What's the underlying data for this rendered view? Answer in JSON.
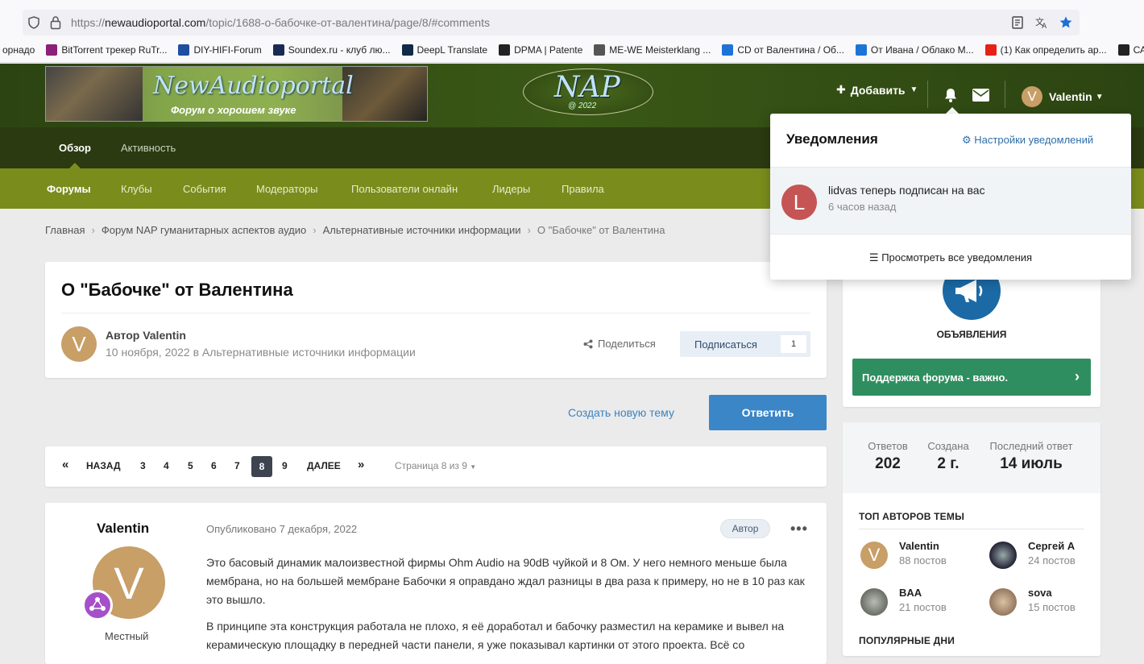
{
  "browser": {
    "url_prefix": "https://",
    "url_host": "newaudioportal.com",
    "url_path": "/topic/1688-о-бабочке-от-валентина/page/8/#comments",
    "bookmarks": [
      {
        "label": "орнадо",
        "color": "#f9f9fb"
      },
      {
        "label": "BitTorrent трекер RuTr...",
        "color": "#8b1f7a"
      },
      {
        "label": "DIY-HIFI-Forum",
        "color": "#1f4fa0"
      },
      {
        "label": "Soundex.ru - клуб лю...",
        "color": "#1a2a55"
      },
      {
        "label": "DeepL Translate",
        "color": "#0f2b46"
      },
      {
        "label": "DPMA | Patente",
        "color": "#222222"
      },
      {
        "label": "ME-WE Meisterklang ...",
        "color": "#555555"
      },
      {
        "label": "CD от Валентина / Об...",
        "color": "#1e74d6"
      },
      {
        "label": "От Ивана / Облако М...",
        "color": "#1e74d6"
      },
      {
        "label": "(1) Как определить ар...",
        "color": "#e62117"
      },
      {
        "label": "САМОР",
        "color": "#222222"
      }
    ]
  },
  "header": {
    "banner_title": "NewAudioportal",
    "banner_subtitle": "Форум о хорошем звуке",
    "logo_text": "NAP",
    "logo_year": "@ 2022",
    "add_label": "Добавить",
    "user_name": "Valentin",
    "user_initial": "V"
  },
  "nav_primary": [
    {
      "label": "Обзор",
      "active": true
    },
    {
      "label": "Активность",
      "active": false
    }
  ],
  "nav_secondary": [
    {
      "label": "Форумы",
      "active": true
    },
    {
      "label": "Клубы",
      "active": false
    },
    {
      "label": "События",
      "active": false
    },
    {
      "label": "Модераторы",
      "active": false
    },
    {
      "label": "Пользователи онлайн",
      "active": false
    },
    {
      "label": "Лидеры",
      "active": false
    },
    {
      "label": "Правила",
      "active": false
    }
  ],
  "breadcrumbs": [
    "Главная",
    "Форум NAP гуманитарных аспектов аудио",
    "Альтернативные источники информации",
    "О \"Бабочке\" от Валентина"
  ],
  "topic": {
    "title": "О \"Бабочке\" от Валентина",
    "author_label": "Автор Valentin",
    "author_initial": "V",
    "meta": "10 ноября, 2022 в Альтернативные источники информации",
    "share_label": "Поделиться",
    "subscribe_label": "Подписаться",
    "subscribe_count": "1",
    "new_topic_label": "Создать новую тему",
    "reply_label": "Ответить"
  },
  "pager": {
    "first": "«",
    "prev": "НАЗАД",
    "pages": [
      "3",
      "4",
      "5",
      "6",
      "7",
      "8",
      "9"
    ],
    "current": "8",
    "next": "ДАЛЕЕ",
    "last": "»",
    "info": "Страница 8 из 9"
  },
  "post": {
    "author": "Valentin",
    "initial": "V",
    "rank": "Местный",
    "date": "Опубликовано 7 декабря, 2022",
    "tag": "Автор",
    "more": "•••",
    "paragraphs": [
      "Это басовый динамик малоизвестной фирмы Ohm Audio на 90dB чуйкой и 8 Ом. У него немного меньше была мембрана, но на большей мембране Бабочки я оправдано ждал разницы в два раза к примеру, но не в 10 раз как это вышло.",
      "В принципе эта конструкция работала не плохо, я её доработал и бабочку разместил на керамике и вывел на керамическую площадку в передней части панели, я уже показывал картинки от этого проекта. Всё со"
    ]
  },
  "sidebar": {
    "announcements_title": "ОБЪЯВЛЕНИЯ",
    "announcement_button": "Поддержка форума - важно.",
    "stats": [
      {
        "label": "Ответов",
        "value": "202"
      },
      {
        "label": "Создана",
        "value": "2 г."
      },
      {
        "label": "Последний ответ",
        "value": "14 июль"
      }
    ],
    "top_authors_title": "ТОП АВТОРОВ ТЕМЫ",
    "top_authors": [
      {
        "name": "Valentin",
        "posts": "88 постов",
        "color": "#c79f67"
      },
      {
        "name": "Сергей А",
        "posts": "24 постов",
        "color": "#2e3440"
      },
      {
        "name": "BAA",
        "posts": "21 постов",
        "color": "#8a8f86"
      },
      {
        "name": "sova",
        "posts": "15 постов",
        "color": "#b89a7a"
      }
    ],
    "popular_days_title": "ПОПУЛЯРНЫЕ ДНИ"
  },
  "notifications": {
    "title": "Уведомления",
    "settings_label": "Настройки уведомлений",
    "items": [
      {
        "initial": "L",
        "text": "lidvas теперь подписан на вас",
        "time": "6 часов назад"
      }
    ],
    "view_all": "Просмотреть все уведомления"
  }
}
